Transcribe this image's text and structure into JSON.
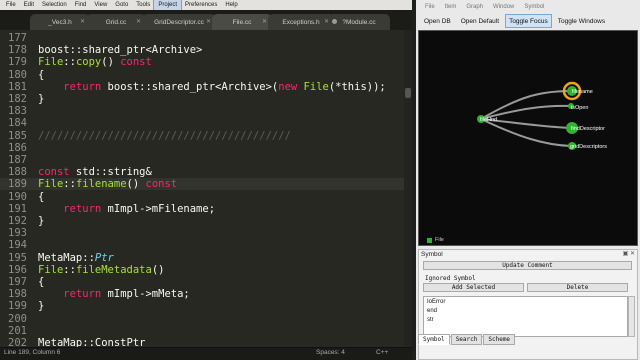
{
  "editor": {
    "menu": [
      "File",
      "Edit",
      "Selection",
      "Find",
      "View",
      "Goto",
      "Tools",
      "Project",
      "Preferences",
      "Help"
    ],
    "tabs": [
      "_Vec3.h",
      "Grid.cc",
      "GridDescriptor.cc",
      "File.cc",
      "Exceptions.h",
      "?Module.cc"
    ],
    "line_numbers": [
      "177",
      "178",
      "179",
      "180",
      "181",
      "182",
      "183",
      "184",
      "185",
      "186",
      "187",
      "188",
      "189",
      "190",
      "191",
      "192",
      "193",
      "194",
      "195",
      "196",
      "197",
      "198",
      "199",
      "200",
      "201",
      "202"
    ],
    "lines": [
      {
        "t": [
          {
            "s": ""
          }
        ]
      },
      {
        "t": [
          {
            "s": "boost::shared_ptr<Archive>"
          }
        ]
      },
      {
        "t": [
          {
            "s": "File",
            "c": "fn"
          },
          {
            "s": "::"
          },
          {
            "s": "copy",
            "c": "fn"
          },
          {
            "s": "() "
          },
          {
            "s": "const",
            "c": "kw"
          }
        ]
      },
      {
        "t": [
          {
            "s": "{"
          }
        ]
      },
      {
        "t": [
          {
            "s": "    "
          },
          {
            "s": "return",
            "c": "kw"
          },
          {
            "s": " boost::shared_ptr<Archive>("
          },
          {
            "s": "new",
            "c": "kw"
          },
          {
            "s": " "
          },
          {
            "s": "File",
            "c": "fn"
          },
          {
            "s": "(*this));"
          }
        ]
      },
      {
        "t": [
          {
            "s": "}"
          }
        ]
      },
      {
        "t": [
          {
            "s": ""
          }
        ]
      },
      {
        "t": [
          {
            "s": ""
          }
        ]
      },
      {
        "t": [
          {
            "s": "////////////////////////////////////////",
            "c": "cm"
          }
        ]
      },
      {
        "t": [
          {
            "s": ""
          }
        ]
      },
      {
        "t": [
          {
            "s": ""
          }
        ]
      },
      {
        "t": [
          {
            "s": "const",
            "c": "kw"
          },
          {
            "s": " std::string&"
          }
        ]
      },
      {
        "t": [
          {
            "s": "File",
            "c": "fn"
          },
          {
            "s": "::"
          },
          {
            "s": "filename",
            "c": "fn"
          },
          {
            "s": "() "
          },
          {
            "s": "const",
            "c": "kw"
          }
        ]
      },
      {
        "t": [
          {
            "s": "{"
          }
        ]
      },
      {
        "t": [
          {
            "s": "    "
          },
          {
            "s": "return",
            "c": "kw"
          },
          {
            "s": " mImpl->mFilename;"
          }
        ]
      },
      {
        "t": [
          {
            "s": "}"
          }
        ]
      },
      {
        "t": [
          {
            "s": ""
          }
        ]
      },
      {
        "t": [
          {
            "s": ""
          }
        ]
      },
      {
        "t": [
          {
            "s": "MetaMap::"
          },
          {
            "s": "Ptr",
            "c": "ty"
          }
        ]
      },
      {
        "t": [
          {
            "s": "File",
            "c": "fn"
          },
          {
            "s": "::"
          },
          {
            "s": "fileMetadata",
            "c": "fn"
          },
          {
            "s": "()"
          }
        ]
      },
      {
        "t": [
          {
            "s": "{"
          }
        ]
      },
      {
        "t": [
          {
            "s": "    "
          },
          {
            "s": "return",
            "c": "kw"
          },
          {
            "s": " mImpl->mMeta;"
          }
        ]
      },
      {
        "t": [
          {
            "s": "}"
          }
        ]
      },
      {
        "t": [
          {
            "s": ""
          }
        ]
      },
      {
        "t": [
          {
            "s": ""
          }
        ]
      },
      {
        "t": [
          {
            "s": "MetaMap::ConstPtr"
          }
        ]
      }
    ],
    "status_position": "Line 189, Column 6",
    "status_spaces": "Spaces: 4",
    "status_syntax": "C++"
  },
  "graph_panel": {
    "menu": [
      "File",
      "Item",
      "Graph",
      "Window",
      "Symbol"
    ],
    "toolbar": [
      "Open DB",
      "Open Default",
      "Toggle Focus",
      "Toggle Windows"
    ],
    "active_toolbar": "Toggle Focus",
    "nodes": [
      "fileHnd",
      "filename",
      "isOpen",
      "findDescriptor",
      "gridDescriptors"
    ],
    "focused_node": "filename",
    "legend": "File",
    "colors": {
      "node": "#2eb32e",
      "focus_ring": "#f2a60e",
      "edge": "#9a9a9a"
    }
  },
  "symbol_panel": {
    "title": "Symbol",
    "controls": "▣ ✕",
    "update_comment": "Update Comment",
    "ignored_symbol_label": "Ignored Symbol",
    "add_selected": "Add Selected",
    "delete": "Delete",
    "items": [
      "IoError",
      "end",
      "str"
    ],
    "tabs": [
      "Symbol",
      "Search",
      "Scheme"
    ]
  }
}
